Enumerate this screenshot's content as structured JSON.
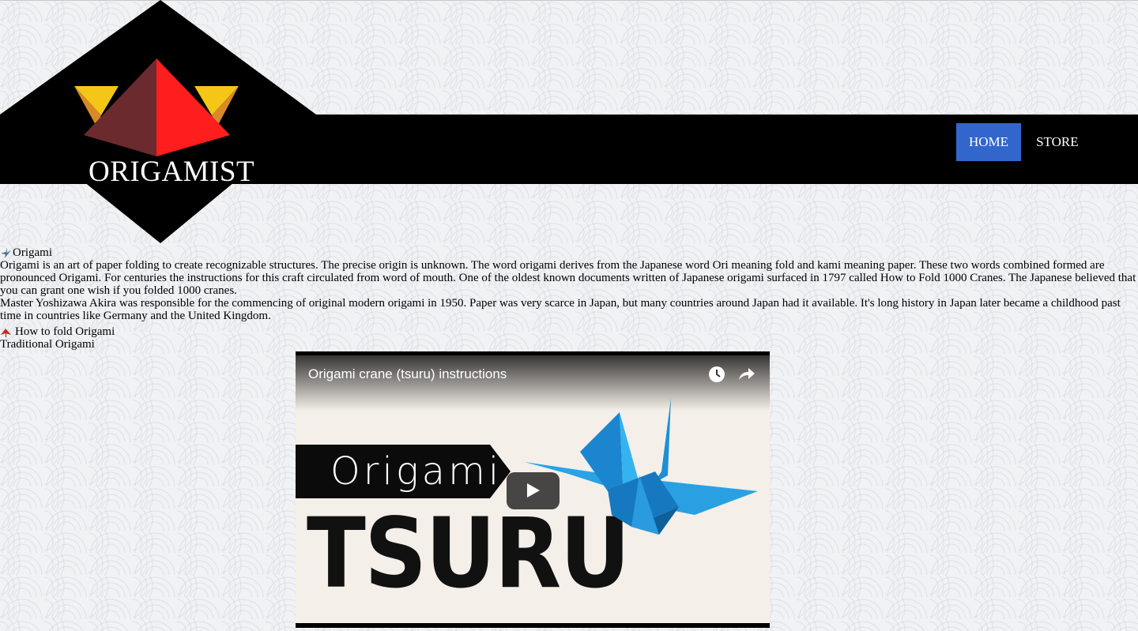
{
  "brand": {
    "name": "ORIGAMIST",
    "colors": {
      "nav_bg": "#000000",
      "active_tab": "#3366cc",
      "logo_red": "#ff1e1e",
      "logo_maroon": "#6b2a2e",
      "logo_gold": "#f5c518",
      "logo_orange": "#d88a28"
    }
  },
  "nav": {
    "items": [
      {
        "label": "HOME",
        "active": true
      },
      {
        "label": "STORE",
        "active": false
      }
    ]
  },
  "content": {
    "section1": {
      "icon": "crane-icon",
      "title": "Origami",
      "paragraph1": "Origami is an art of paper folding to create recognizable structures. The precise origin is unknown. The word origami derives from the Japanese word Ori meaning fold and kami meaning paper. These two words combined formed are pronounced Origami. For centuries the instructions for this craft circulated from word of mouth. One of the oldest known documents written of Japanese origami surfaced in 1797 called How to Fold 1000 Cranes. The Japanese believed that you can grant one wish if you folded 1000 cranes.",
      "paragraph2": "Master Yoshizawa Akira was responsible for the commencing of original modern origami in 1950. Paper was very scarce in Japan, but many countries around Japan had it available. It's long history in Japan later became a childhood past time in countries like Germany and the United Kingdom."
    },
    "section2": {
      "icon": "leaf-icon",
      "title": "How to fold Origami",
      "subtitle": "Traditional Origami"
    }
  },
  "video": {
    "title": "Origami crane (tsuru) instructions",
    "thumb_banner": "Origami",
    "thumb_title": "TSURU",
    "controls": [
      "clock-icon",
      "share-icon",
      "play-icon"
    ]
  }
}
